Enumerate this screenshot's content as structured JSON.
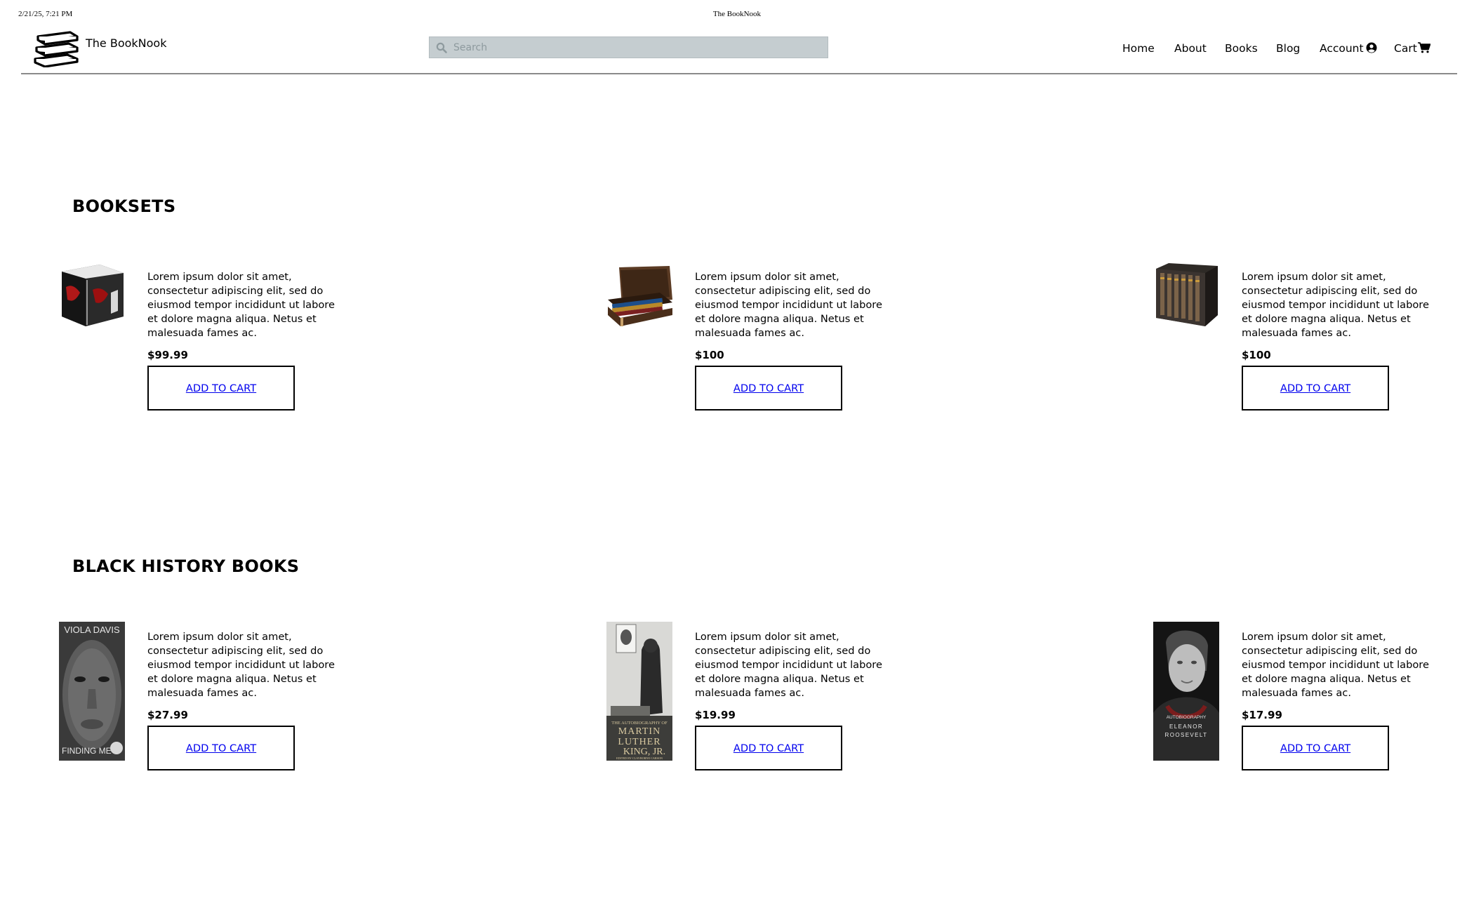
{
  "print_header": {
    "timestamp": "2/21/25, 7:21 PM",
    "page_title": "The BookNook"
  },
  "header": {
    "brand": "The BookNook",
    "search_placeholder": "Search",
    "nav": [
      {
        "label": "Home"
      },
      {
        "label": "About"
      },
      {
        "label": "Books"
      },
      {
        "label": "Blog"
      },
      {
        "label": "Account",
        "icon": "user-circle-icon"
      },
      {
        "label": "Cart",
        "icon": "shopping-cart-icon"
      }
    ]
  },
  "sections": [
    {
      "title": "BOOKSETS",
      "products": [
        {
          "image": "twilight-box-set-image",
          "description": "Lorem ipsum dolor sit amet, consectetur adipiscing elit, sed do eiusmod tempor incididunt ut labore et dolore magna aliqua. Netus et malesuada fames ac.",
          "price": "$99.99",
          "button": "ADD TO CART"
        },
        {
          "image": "harry-potter-trunk-set-image",
          "description": "Lorem ipsum dolor sit amet, consectetur adipiscing elit, sed do eiusmod tempor incididunt ut labore et dolore magna aliqua. Netus et malesuada fames ac.",
          "price": "$100",
          "button": "ADD TO CART"
        },
        {
          "image": "book-box-set-image",
          "description": "Lorem ipsum dolor sit amet, consectetur adipiscing elit, sed do eiusmod tempor incididunt ut labore et dolore magna aliqua. Netus et malesuada fames ac.",
          "price": "$100",
          "button": "ADD TO CART"
        }
      ]
    },
    {
      "title": "BLACK HISTORY BOOKS",
      "products": [
        {
          "image": "finding-me-cover-image",
          "cover_lines": [
            "VIOLA DAVIS",
            "FINDING ME"
          ],
          "description": "Lorem ipsum dolor sit amet, consectetur adipiscing elit, sed do eiusmod tempor incididunt ut labore et dolore magna aliqua. Netus et malesuada fames ac.",
          "price": "$27.99",
          "button": "ADD TO CART"
        },
        {
          "image": "mlk-autobiography-cover-image",
          "cover_lines": [
            "THE AUTOBIOGRAPHY OF",
            "MARTIN",
            "LUTHER",
            "KING, JR.",
            "EDITED BY CLAYBORNE CARSON"
          ],
          "description": "Lorem ipsum dolor sit amet, consectetur adipiscing elit, sed do eiusmod tempor incididunt ut labore et dolore magna aliqua. Netus et malesuada fames ac.",
          "price": "$19.99",
          "button": "ADD TO CART"
        },
        {
          "image": "eleanor-roosevelt-cover-image",
          "cover_lines": [
            "AUTOBIOGRAPHY",
            "ELEANOR",
            "ROOSEVELT"
          ],
          "description": "Lorem ipsum dolor sit amet, consectetur adipiscing elit, sed do eiusmod tempor incididunt ut labore et dolore magna aliqua. Netus et malesuada fames ac.",
          "price": "$17.99",
          "button": "ADD TO CART"
        }
      ]
    }
  ]
}
